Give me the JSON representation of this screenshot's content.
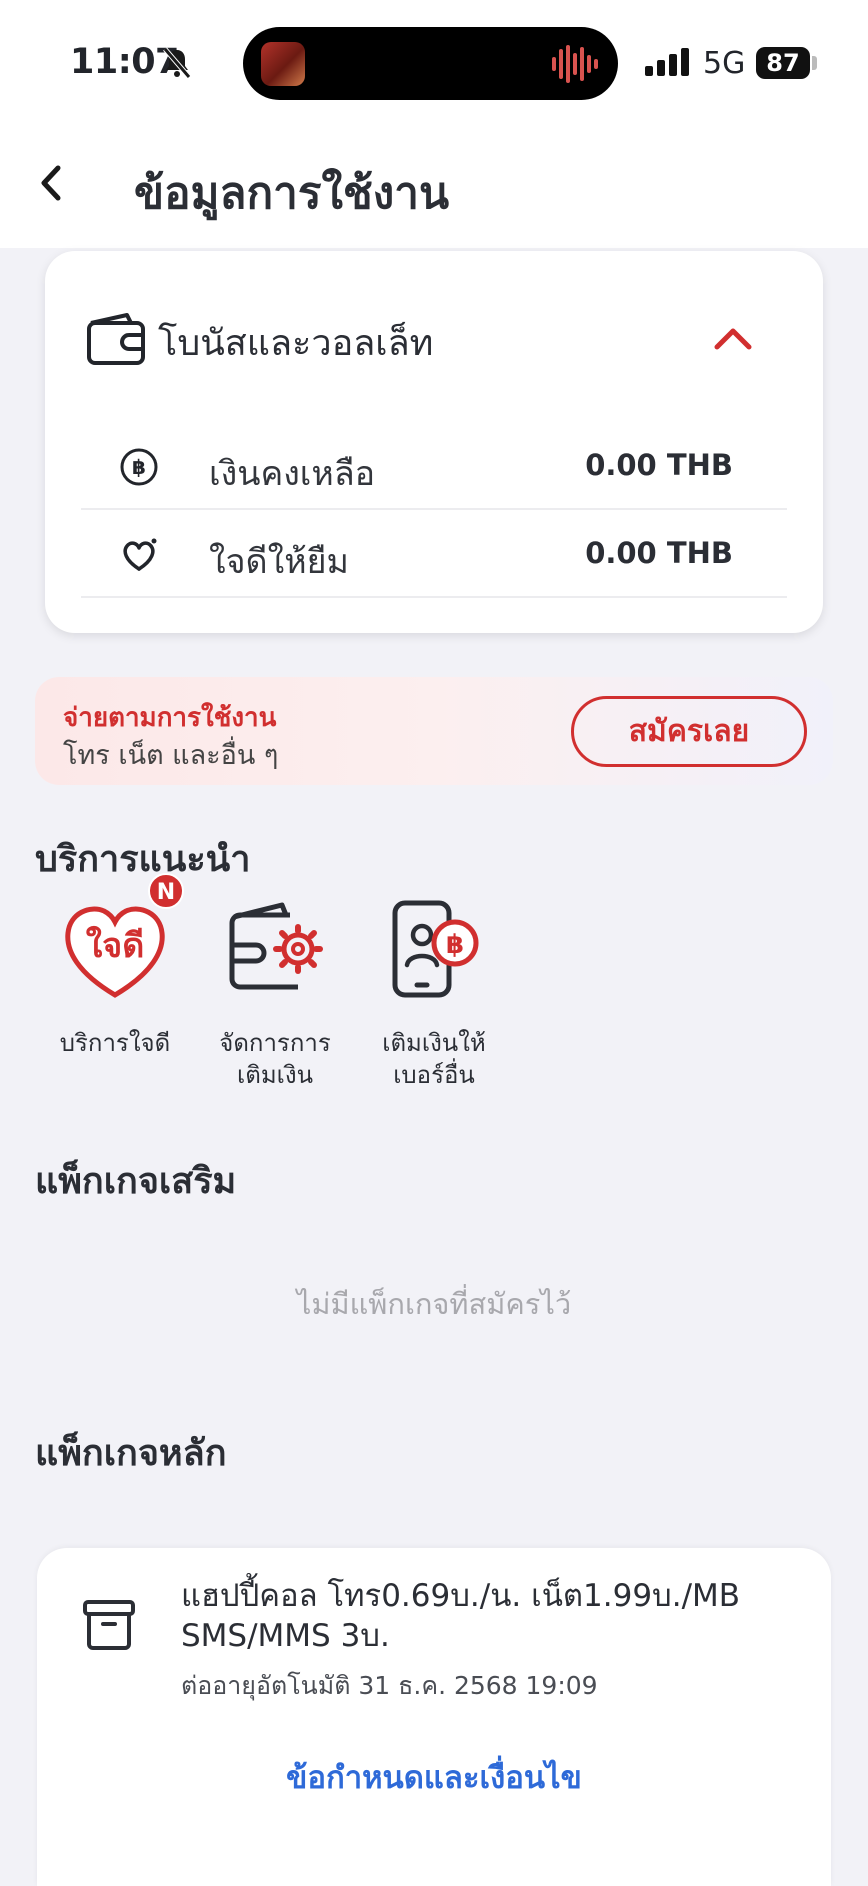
{
  "status_bar": {
    "time": "11:07",
    "network": "5G",
    "battery": "87"
  },
  "nav": {
    "title": "ข้อมูลการใช้งาน"
  },
  "wallet_card": {
    "title": "โบนัสและวอลเล็ท",
    "rows": [
      {
        "label": "เงินคงเหลือ",
        "value": "0.00 THB",
        "icon": "baht-coin-icon"
      },
      {
        "label": "ใจดีให้ยืม",
        "value": "0.00 THB",
        "icon": "heart-icon"
      }
    ]
  },
  "promo": {
    "title": "จ่ายตามการใช้งาน",
    "subtitle": "โทร เน็ต และอื่น ๆ",
    "button_label": "สมัครเลย"
  },
  "recommended": {
    "title": "บริการแนะนำ",
    "items": [
      {
        "label": "บริการใจดี",
        "icon": "jaidee-heart-icon",
        "icon_text": "ใจดี",
        "badge": "N"
      },
      {
        "label": "จัดการการ\nเติมเงิน",
        "icon": "wallet-settings-icon"
      },
      {
        "label": "เติมเงินให้\nเบอร์อื่น",
        "icon": "phone-topup-icon"
      }
    ]
  },
  "addon_packages": {
    "title": "แพ็กเกจเสริม",
    "empty_text": "ไม่มีแพ็กเกจที่สมัครไว้"
  },
  "main_package": {
    "title": "แพ็กเกจหลัก",
    "name": "แฮปปี้คอล โทร0.69บ./น. เน็ต1.99บ./MB SMS/MMS 3บ.",
    "renewal": "ต่ออายุอัตโนมัติ 31 ธ.ค. 2568 19:09",
    "terms_link": "ข้อกำหนดและเงื่อนไข"
  },
  "colors": {
    "accent_red": "#d12f2f",
    "link_blue": "#2e6ad8",
    "background": "#f2f2f7"
  }
}
